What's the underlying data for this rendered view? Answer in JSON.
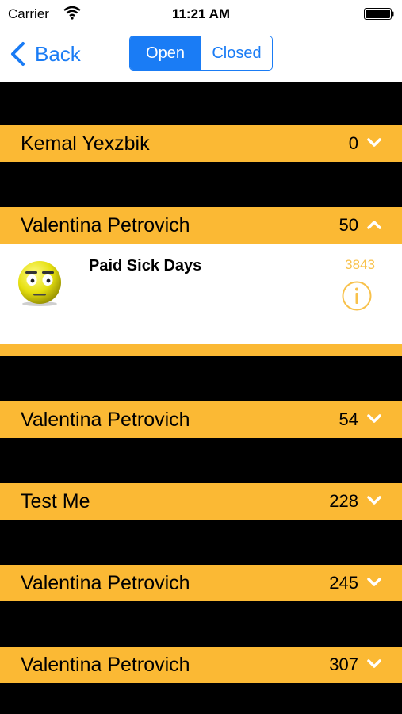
{
  "status_bar": {
    "carrier": "Carrier",
    "time": "11:21 AM",
    "wifi_icon": "wifi-icon",
    "battery_icon": "battery-icon"
  },
  "nav": {
    "back_label": "Back",
    "segments": [
      {
        "label": "Open",
        "selected": true
      },
      {
        "label": "Closed",
        "selected": false
      }
    ]
  },
  "rows": [
    {
      "name": "Kemal Yexzbik",
      "count": "0",
      "chevron": "chevron-down-icon"
    },
    {
      "name": "Valentina Petrovich",
      "count": "50",
      "chevron": "chevron-up-icon"
    },
    {
      "name": "Valentina Petrovich",
      "count": "54",
      "chevron": "chevron-down-icon"
    },
    {
      "name": "Test Me",
      "count": "228",
      "chevron": "chevron-down-icon"
    },
    {
      "name": "Valentina Petrovich",
      "count": "245",
      "chevron": "chevron-down-icon"
    },
    {
      "name": "Valentina Petrovich",
      "count": "307",
      "chevron": "chevron-down-icon"
    }
  ],
  "expanded": {
    "title": "Paid Sick Days",
    "number": "3843",
    "avatar_icon": "smiley-face-icon",
    "info_icon": "info-icon"
  },
  "colors": {
    "row_background": "#fbb934",
    "accent_blue": "#1a7cf5",
    "detail_number": "#f8c14a",
    "background": "#000000"
  }
}
